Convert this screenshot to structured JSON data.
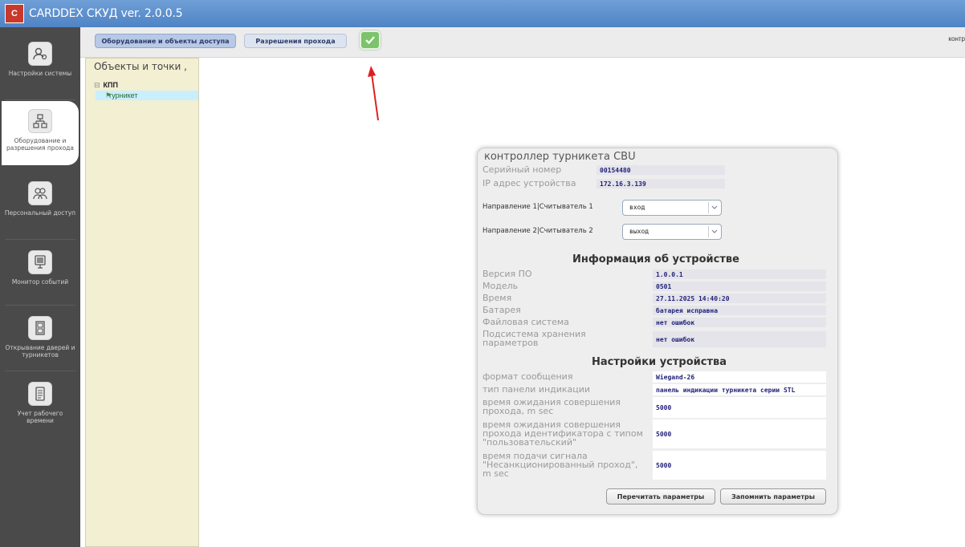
{
  "window": {
    "logo_text": "C",
    "title": "CARDDEX СКУД ver. 2.0.0.5"
  },
  "sidebar": {
    "items": [
      {
        "label": "Настройки системы",
        "icon": "settings-person-icon"
      },
      {
        "label": "Оборудование и разрешения прохода",
        "icon": "network-hierarchy-icon",
        "active": true
      },
      {
        "label": "Персональный доступ",
        "icon": "people-group-icon"
      },
      {
        "label": "Монитор событий",
        "icon": "monitor-icon"
      },
      {
        "label": "Открывание дверей и турникетов",
        "icon": "door-icon"
      },
      {
        "label": "Учет рабочего времени",
        "icon": "document-icon"
      }
    ]
  },
  "tabs": {
    "equipment": "Оборудование и объекты доступа",
    "permissions": "Разрешения прохода",
    "right_text": "контр"
  },
  "tree": {
    "header": "Объекты и точки ,",
    "root": "КПП",
    "child": "турникет"
  },
  "dialog": {
    "title": "контроллер турникета CBU",
    "serial_label": "Серийный номер",
    "serial_value": "00154480",
    "ip_label": "IP адрес устройства",
    "ip_value": "172.16.3.139",
    "dir1_label": "Направление 1|Считыватель 1",
    "dir1_value": "вход",
    "dir2_label": "Направление 2|Считыватель 2",
    "dir2_value": "выход",
    "info_title": "Информация об устройстве",
    "info": [
      {
        "label": "Версия ПО",
        "value": "1.0.0.1"
      },
      {
        "label": "Модель",
        "value": "0501"
      },
      {
        "label": "Время",
        "value": "27.11.2025 14:40:20"
      },
      {
        "label": "Батарея",
        "value": "батарея исправна"
      },
      {
        "label": "Файловая система",
        "value": "нет ошибок"
      },
      {
        "label": "Подсистема хранения параметров",
        "value": "нет ошибок"
      }
    ],
    "settings_title": "Настройки устройства",
    "settings": [
      {
        "label": "формат сообщения",
        "value": "Wiegand-26"
      },
      {
        "label": "тип панели индикации",
        "value": "панель индикации турникета серии STL"
      },
      {
        "label": "время ожидания совершения прохода, m sec",
        "value": "5000"
      },
      {
        "label": "время ожидания совершения прохода идентификатора с типом \"пользовательский\"",
        "value": "5000"
      },
      {
        "label": "время подачи сигнала \"Несанкционированный проход\", m sec",
        "value": "5000"
      }
    ],
    "btn_reread": "Перечитать параметры",
    "btn_save": "Запомнить параметры"
  },
  "colors": {
    "titlebar": "#4f83c4",
    "sidebar": "#4a4a4a",
    "confirm": "#7bc46b",
    "arrow": "#e02020"
  }
}
